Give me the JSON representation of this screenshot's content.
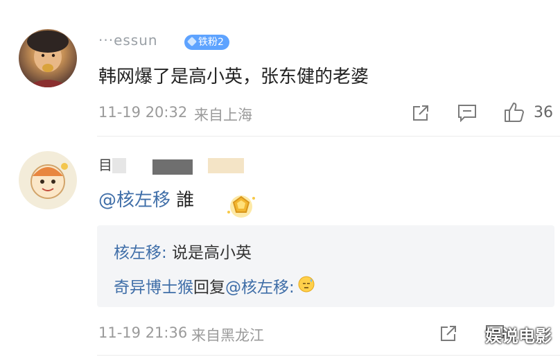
{
  "comments": [
    {
      "username_visible": "···essun",
      "badge_label": "铁粉2",
      "text": "韩网爆了是高小英，张东健的老婆",
      "timestamp": "11-19 20:32",
      "location": "来自上海",
      "like_count": "36"
    },
    {
      "username_visible": "目",
      "mention": "@核左移",
      "text": "誰",
      "replies": [
        {
          "name": "核左移",
          "sep": ":",
          "text": " 说是高小英"
        },
        {
          "name": "奇异博士猴",
          "mid": "回复",
          "mention": "@核左移",
          "sep": ":"
        }
      ],
      "timestamp": "11-19 21:36",
      "location": "来自黑龙江"
    }
  ],
  "icons": [
    "avatar",
    "share-icon",
    "comment-icon",
    "like-icon",
    "gold-badge-icon",
    "emoji-sweat-icon"
  ],
  "watermark": "娱说电影",
  "colors": {
    "link": "#3f6ea8",
    "badge": "#5ea3ff",
    "meta": "#9a9a9a"
  }
}
